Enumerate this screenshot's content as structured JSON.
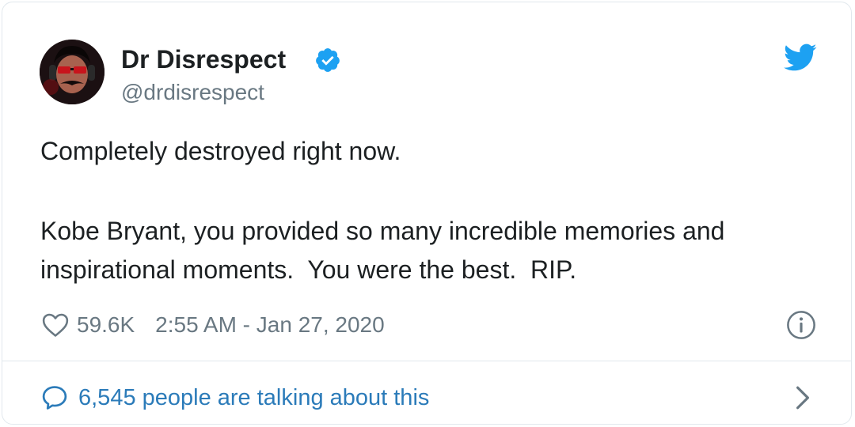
{
  "author": {
    "name": "Dr Disrespect",
    "handle": "@drdisrespect",
    "verified": true,
    "avatar_icon": "avatar-image"
  },
  "tweet": {
    "lines": [
      "Completely destroyed right now.",
      "Kobe Bryant, you provided so many incredible memories and",
      "inspirational moments.  You were the best.  RIP."
    ]
  },
  "meta": {
    "likes": "59.6K",
    "timestamp": "2:55 AM - Jan 27, 2020"
  },
  "footer": {
    "talking": "6,545 people are talking about this"
  },
  "colors": {
    "text": "#1c2022",
    "muted": "#697882",
    "link": "#2b7bb9",
    "twitter_blue": "#1da1f2",
    "border": "#e1e8ed"
  },
  "icons": {
    "verified": "verified-badge-icon",
    "brand": "twitter-bird-icon",
    "like": "heart-icon",
    "info": "info-icon",
    "reply": "speech-bubble-icon",
    "more": "chevron-right-icon"
  }
}
